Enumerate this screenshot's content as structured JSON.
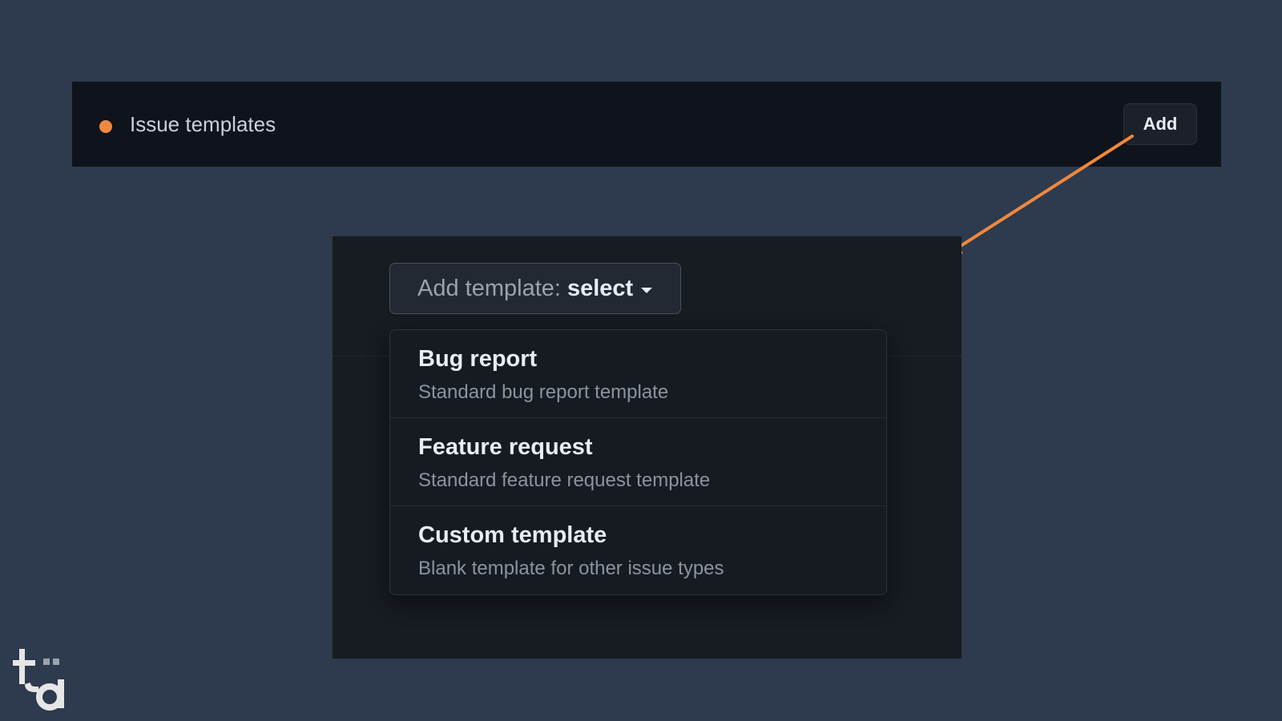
{
  "colors": {
    "background": "#2e3a4d",
    "accent": "#f0883e",
    "header_bg": "#0f131b",
    "panel_bg": "#171b22"
  },
  "header": {
    "status_dot_color": "#f0883e",
    "title": "Issue templates",
    "add_label": "Add"
  },
  "panel": {
    "select_label": "Add template:",
    "select_value": "select",
    "menu": [
      {
        "title": "Bug report",
        "description": "Standard bug report template"
      },
      {
        "title": "Feature request",
        "description": "Standard feature request template"
      },
      {
        "title": "Custom template",
        "description": "Blank template for other issue types"
      }
    ]
  },
  "icons": {
    "status": "status-dot-icon",
    "caret": "caret-down-icon",
    "arrow": "arrow-annotation-icon",
    "logo": "ta-logo"
  },
  "logo_text": "ta"
}
